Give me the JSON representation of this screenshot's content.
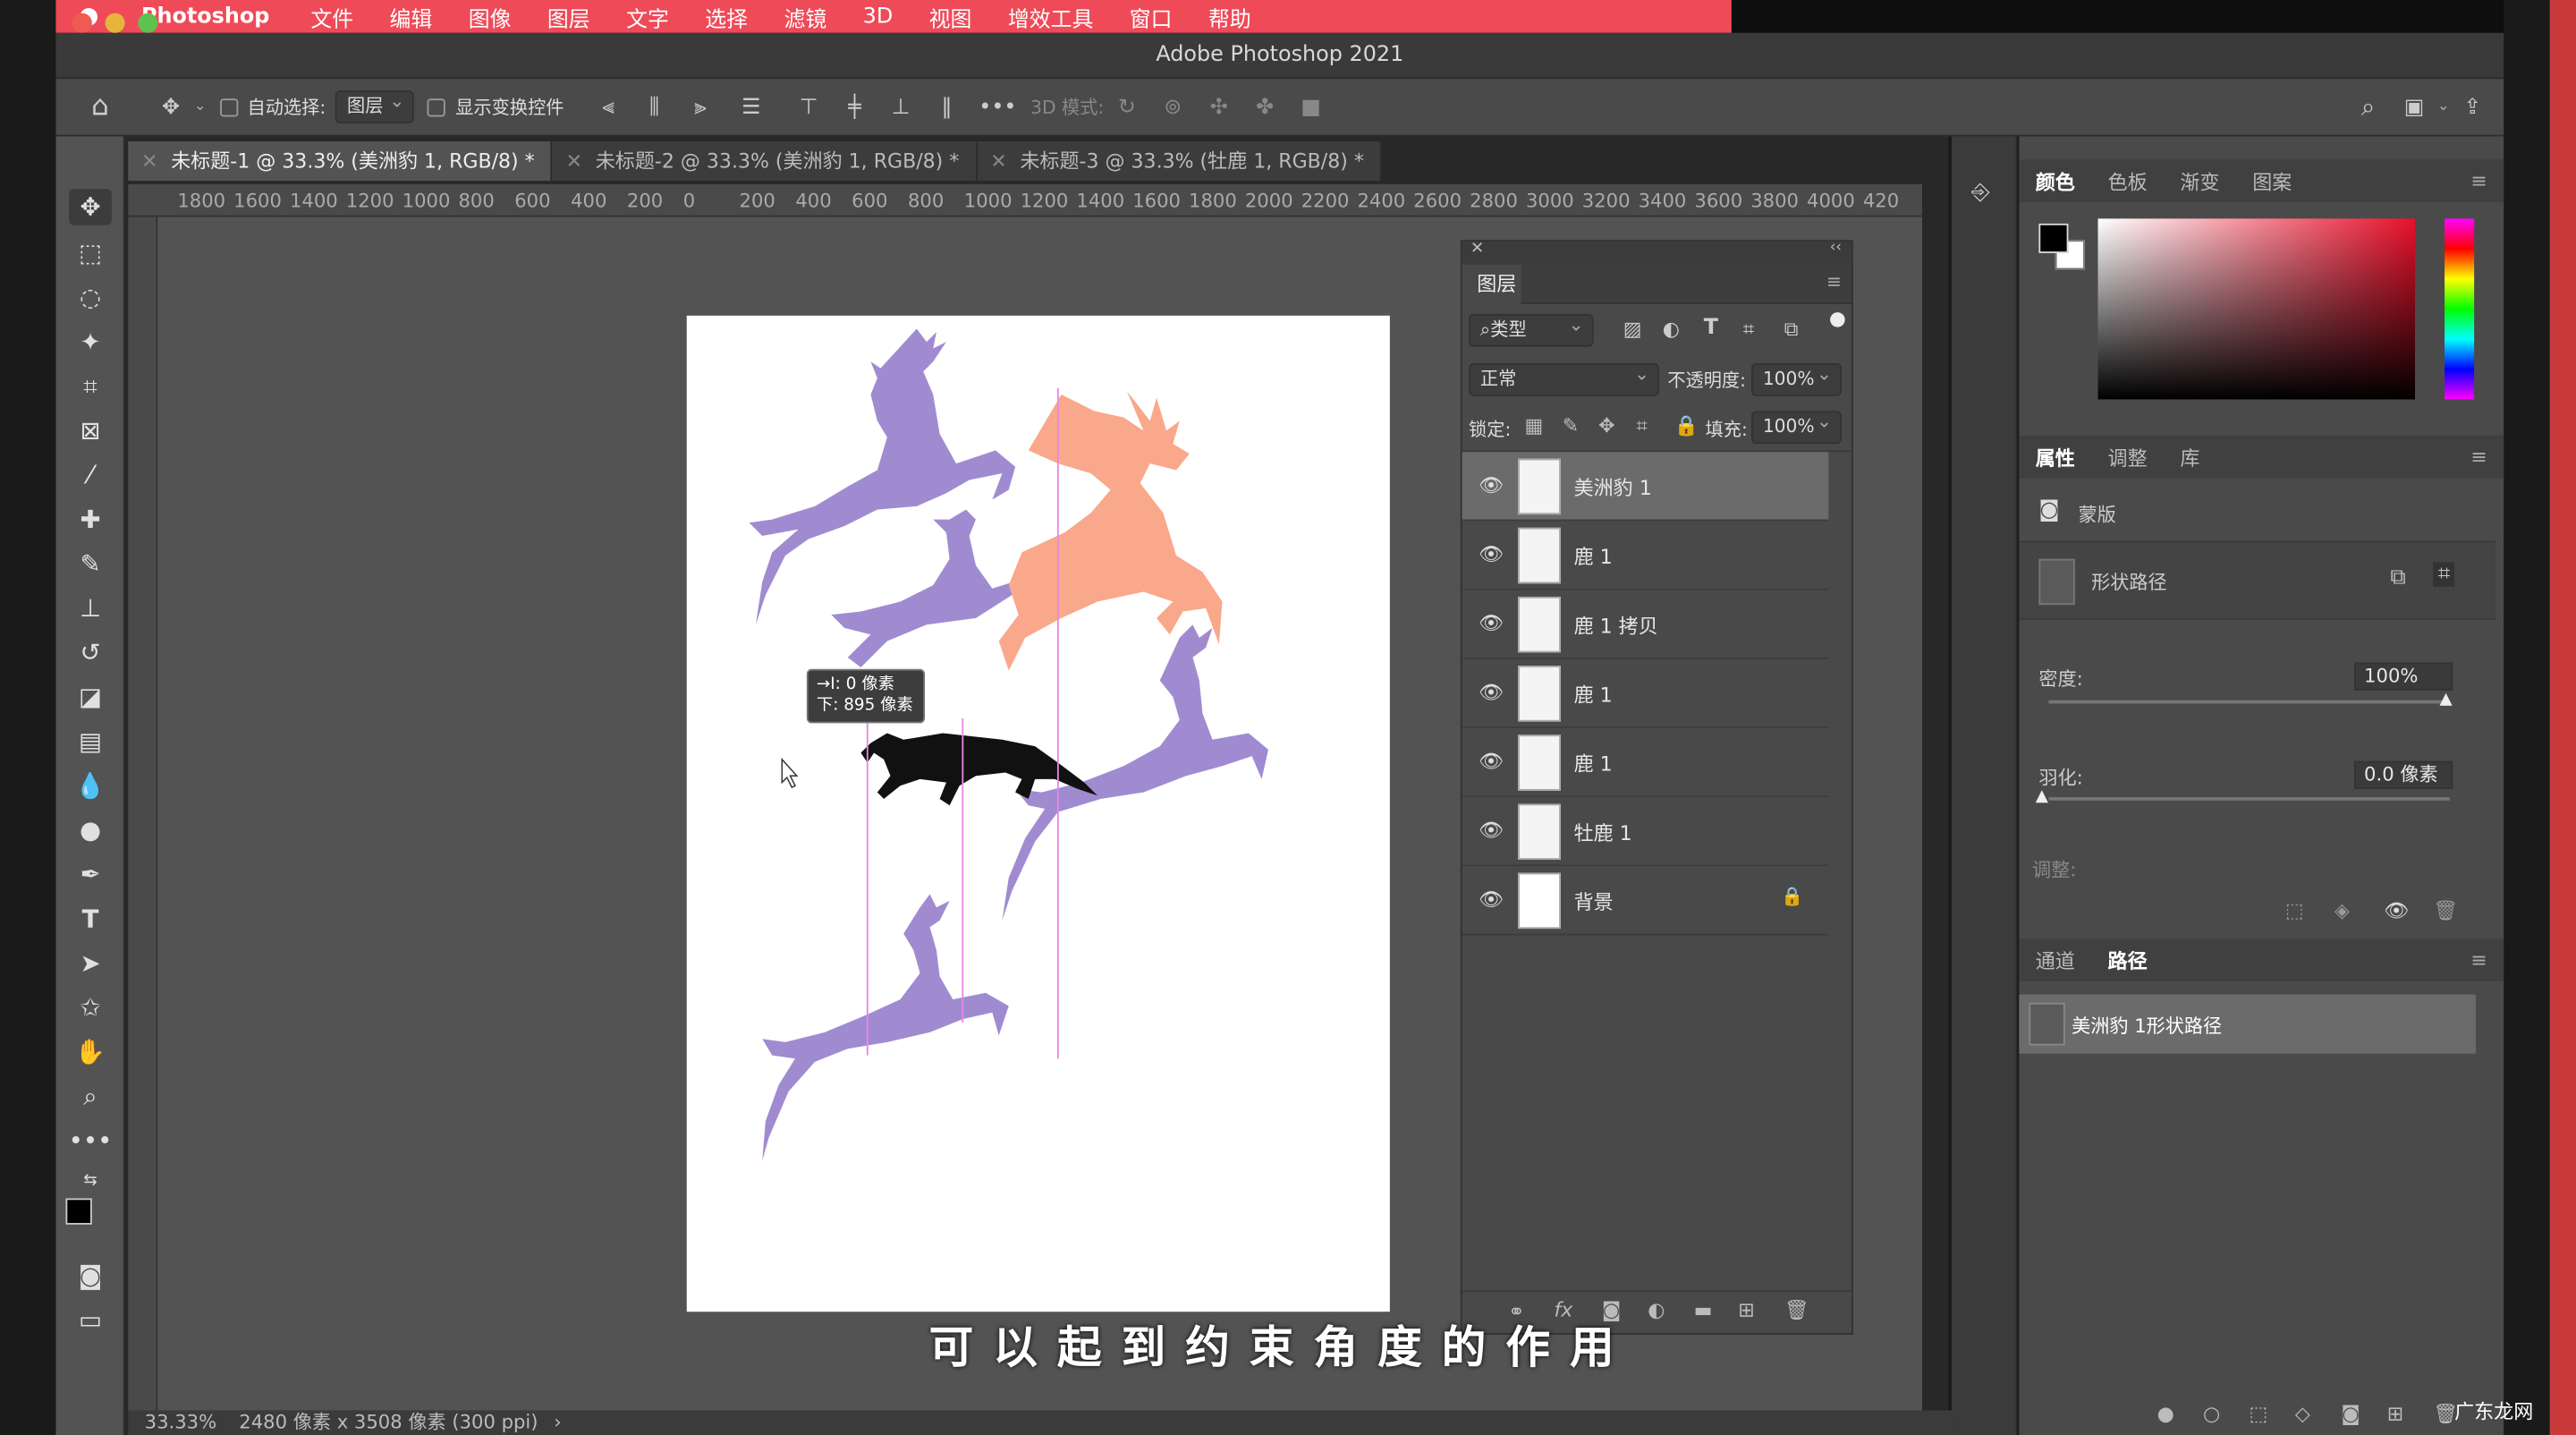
{
  "menubar": {
    "app_name": "Photoshop",
    "items": [
      "文件",
      "编辑",
      "图像",
      "图层",
      "文字",
      "选择",
      "滤镜",
      "3D",
      "视图",
      "增效工具",
      "窗口",
      "帮助"
    ]
  },
  "window": {
    "title": "Adobe Photoshop 2021"
  },
  "options_bar": {
    "auto_select_label": "自动选择:",
    "auto_select_value": "图层",
    "show_transform_label": "显示变换控件",
    "mode_3d_label": "3D 模式:"
  },
  "tabs": [
    {
      "label": "未标题-1 @ 33.3% (美洲豹 1, RGB/8) *"
    },
    {
      "label": "未标题-2 @ 33.3% (美洲豹 1, RGB/8) *"
    },
    {
      "label": "未标题-3 @ 33.3% (牡鹿 1, RGB/8) *"
    }
  ],
  "ruler": {
    "top_ticks": [
      "1800",
      "1600",
      "1400",
      "1200",
      "1000",
      "800",
      "600",
      "400",
      "200",
      "0",
      "200",
      "400",
      "600",
      "800",
      "1000",
      "1200",
      "1400",
      "1600",
      "1800",
      "2000",
      "2200",
      "2400",
      "2600",
      "2800",
      "3000",
      "3200",
      "3400",
      "3600",
      "3800",
      "4000",
      "420"
    ]
  },
  "canvas": {
    "tooltip_line1": "→I:    0 像素",
    "tooltip_line2": "下: 895 像素",
    "colors": {
      "deer_purple": "#a08bd1",
      "stag_salmon": "#f9a88b",
      "jaguar": "#111111",
      "guide": "#e688e6"
    }
  },
  "status": {
    "zoom": "33.33%",
    "doc_info": "2480 像素 x 3508 像素 (300 ppi)"
  },
  "layers_panel": {
    "title": "图层",
    "filter_kind": "类型",
    "blend_mode": "正常",
    "opacity_label": "不透明度:",
    "opacity_value": "100%",
    "lock_label": "锁定:",
    "fill_label": "填充:",
    "fill_value": "100%",
    "layers": [
      {
        "name": "美洲豹 1",
        "selected": true
      },
      {
        "name": "鹿 1",
        "selected": false
      },
      {
        "name": "鹿 1 拷贝",
        "selected": false
      },
      {
        "name": "鹿 1",
        "selected": false
      },
      {
        "name": "鹿 1",
        "selected": false
      },
      {
        "name": "牡鹿 1",
        "selected": false
      },
      {
        "name": "背景",
        "selected": false,
        "locked": true
      }
    ]
  },
  "color_panel": {
    "tabs": [
      "颜色",
      "色板",
      "渐变",
      "图案"
    ],
    "active": "颜色",
    "foreground": "#000000",
    "background": "#ffffff"
  },
  "properties_panel": {
    "tabs": [
      "属性",
      "调整",
      "库"
    ],
    "active": "属性",
    "section_label": "蒙版",
    "shape_path_label": "形状路径",
    "density_label": "密度:",
    "density_value": "100%",
    "feather_label": "羽化:",
    "feather_value": "0.0 像素",
    "adjust_label": "调整:"
  },
  "paths_panel": {
    "tabs": [
      "通道",
      "路径"
    ],
    "active": "路径",
    "items": [
      {
        "name": "美洲豹 1形状路径"
      }
    ]
  },
  "subtitle": "可以起到约束角度的作用",
  "watermark": "广东龙网"
}
